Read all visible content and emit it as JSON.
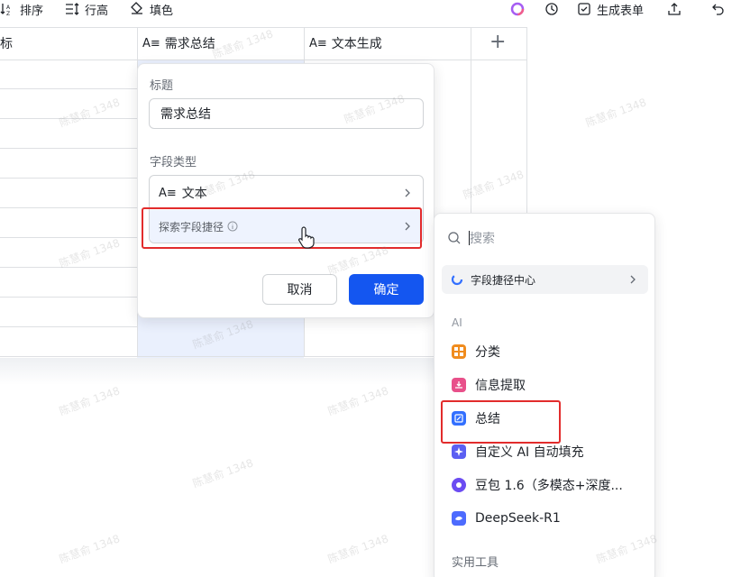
{
  "toolbar": {
    "sort": "排序",
    "row_height": "行高",
    "fill_color": "填色",
    "generate_form": "生成表单"
  },
  "table": {
    "columns": [
      {
        "label": "目标"
      },
      {
        "label": "需求总结"
      },
      {
        "label": "文本生成"
      }
    ],
    "add_column": "+"
  },
  "field_editor": {
    "title_label": "标题",
    "title_value": "需求总结",
    "type_label": "字段类型",
    "type_value": "文本",
    "explore_shortcut": "探索字段捷径",
    "cancel": "取消",
    "confirm": "确定"
  },
  "shortcut_menu": {
    "search_placeholder": "搜索",
    "center": "字段捷径中心",
    "section_ai": "AI",
    "items": [
      {
        "label": "分类",
        "icon": "grid-icon",
        "color": "#f08c1e"
      },
      {
        "label": "信息提取",
        "icon": "extract-icon",
        "color": "#e8508a"
      },
      {
        "label": "总结",
        "icon": "summary-icon",
        "color": "#3370ff"
      },
      {
        "label": "自定义 AI 自动填充",
        "icon": "sparkle-icon",
        "color": "#5b5ff2"
      },
      {
        "label": "豆包 1.6（多模态+深度...",
        "icon": "doubao-icon",
        "color": "#6b4cf2"
      },
      {
        "label": "DeepSeek-R1",
        "icon": "deepseek-icon",
        "color": "#4d6bfe"
      }
    ],
    "section_tools": "实用工具"
  },
  "watermark": "陈慧俞 1348"
}
